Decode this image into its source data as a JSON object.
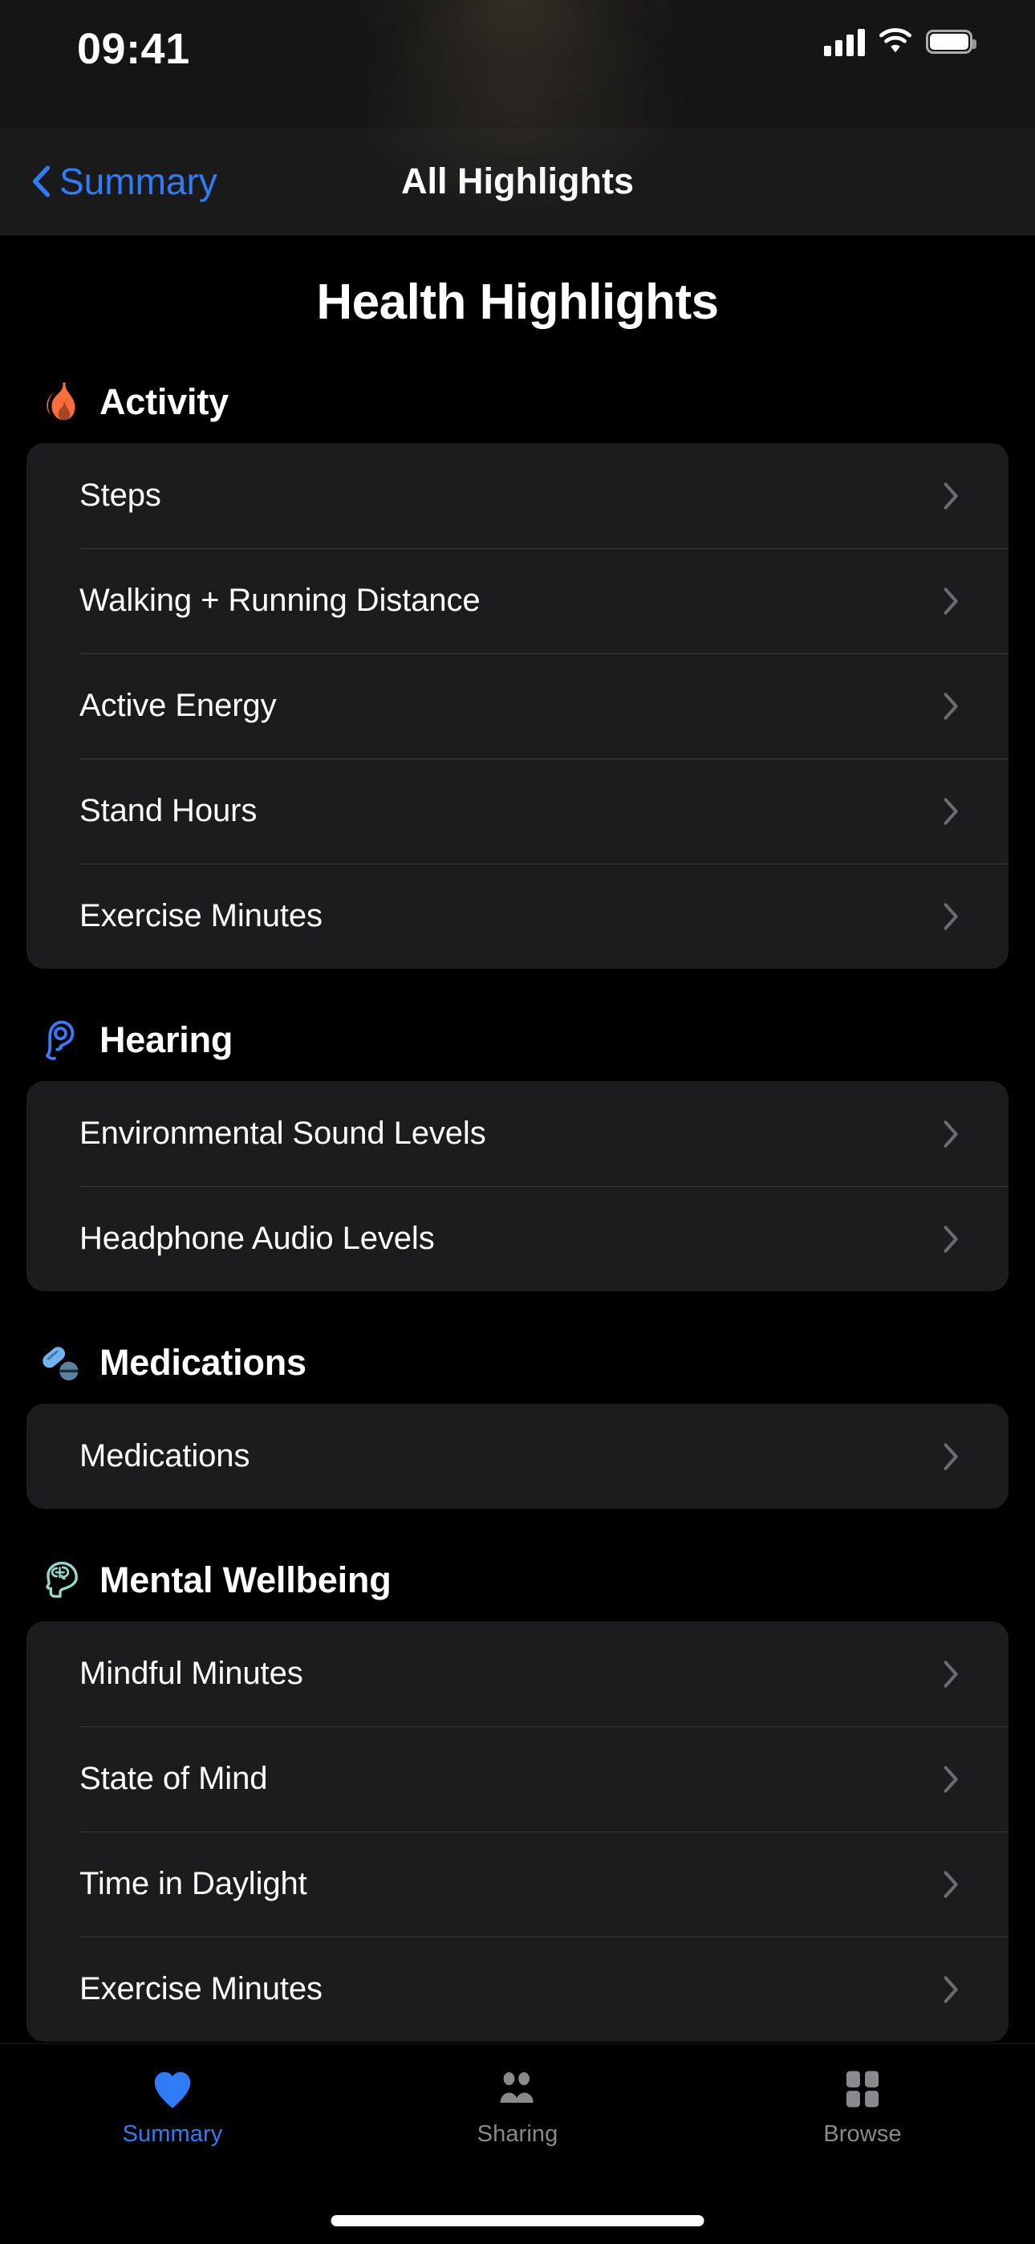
{
  "status_bar": {
    "time": "09:41",
    "cellular_icon": "cellular-signal-icon",
    "wifi_icon": "wifi-icon",
    "battery_icon": "battery-icon"
  },
  "nav_bar": {
    "back_label": "Summary",
    "back_icon": "chevron-left-icon",
    "title": "All Highlights"
  },
  "page": {
    "title": "Health Highlights"
  },
  "sections": [
    {
      "id": "activity",
      "title": "Activity",
      "icon": "flame-icon",
      "icon_color": "#FB6D3A",
      "rows": [
        {
          "label": "Steps"
        },
        {
          "label": "Walking + Running Distance"
        },
        {
          "label": "Active Energy"
        },
        {
          "label": "Stand Hours"
        },
        {
          "label": "Exercise Minutes"
        }
      ]
    },
    {
      "id": "hearing",
      "title": "Hearing",
      "icon": "ear-icon",
      "icon_color": "#3B7BF7",
      "rows": [
        {
          "label": "Environmental Sound Levels"
        },
        {
          "label": "Headphone Audio Levels"
        }
      ]
    },
    {
      "id": "medications",
      "title": "Medications",
      "icon": "pills-icon",
      "icon_color": "#6FB4F0",
      "rows": [
        {
          "label": "Medications"
        }
      ]
    },
    {
      "id": "mental-wellbeing",
      "title": "Mental Wellbeing",
      "icon": "head-brain-icon",
      "icon_color": "#92D9CE",
      "rows": [
        {
          "label": "Mindful Minutes"
        },
        {
          "label": "State of Mind"
        },
        {
          "label": "Time in Daylight"
        },
        {
          "label": "Exercise Minutes"
        }
      ]
    }
  ],
  "row_accessory_icon": "chevron-right-icon",
  "tab_bar": {
    "active_index": 0,
    "accent_color": "#2F7CF6",
    "inactive_color": "#8A8A8E",
    "tabs": [
      {
        "label": "Summary",
        "icon": "heart-icon"
      },
      {
        "label": "Sharing",
        "icon": "people-icon"
      },
      {
        "label": "Browse",
        "icon": "grid-icon"
      }
    ]
  }
}
